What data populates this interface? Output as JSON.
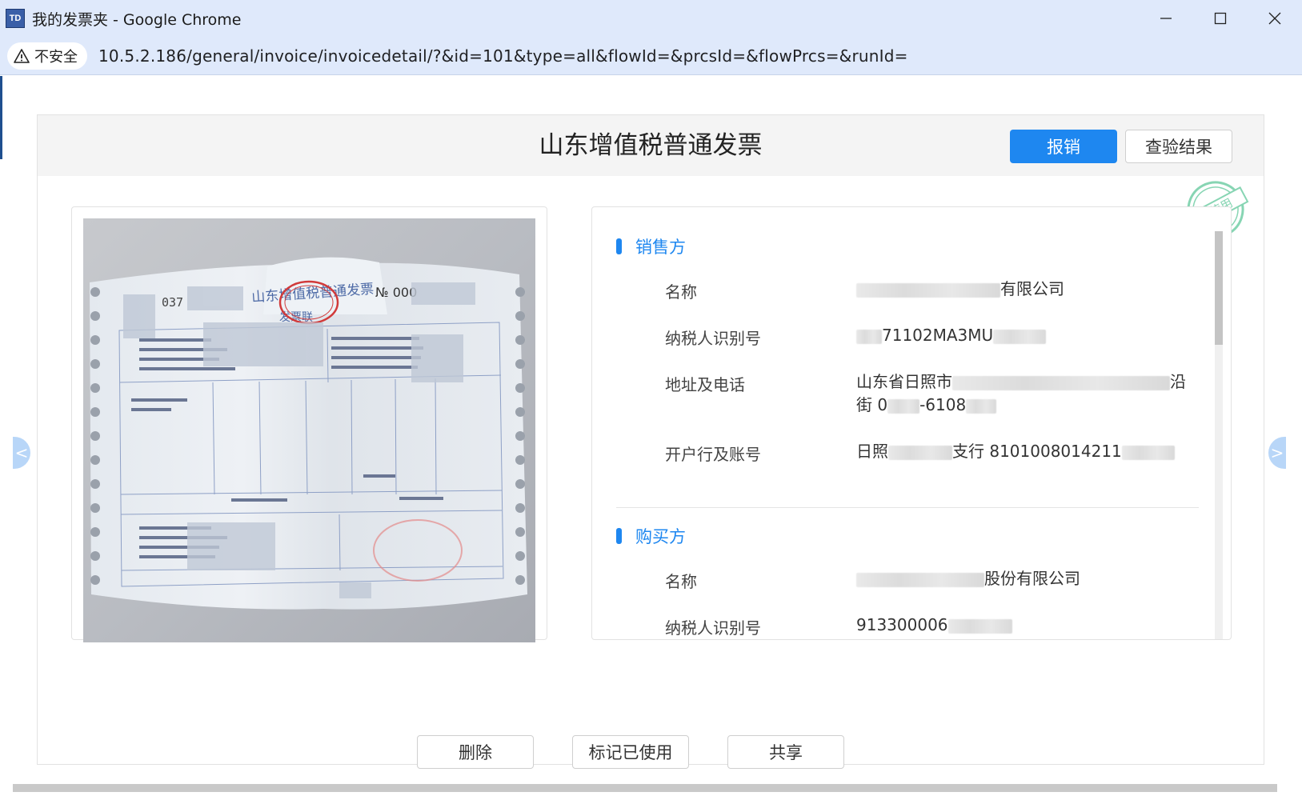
{
  "window": {
    "app_icon_text": "TD",
    "title": "我的发票夹 - Google Chrome"
  },
  "addressbar": {
    "security_label": "不安全",
    "url": "10.5.2.186/general/invoice/invoicedetail/?&id=101&type=all&flowId=&prcsId=&flowPrcs=&runId="
  },
  "invoice": {
    "title": "山东增值税普通发票",
    "reimburse_label": "报销",
    "verify_label": "查验结果",
    "stamp_text": "未使用"
  },
  "seller": {
    "section_title": "销售方",
    "name_label": "名称",
    "name_value": "有限公司",
    "taxid_label": "纳税人识别号",
    "taxid_value": "71102MA3MU",
    "address_label": "地址及电话",
    "address_value_1": "山东省日照市",
    "address_value_1_tail": "沿",
    "address_value_2_head": "街 0",
    "address_value_2_mid": "-6108",
    "bank_label": "开户行及账号",
    "bank_value_head": "日照",
    "bank_value_mid": "支行 8101008014211"
  },
  "buyer": {
    "section_title": "购买方",
    "name_label": "名称",
    "name_value": "股份有限公司",
    "taxid_label": "纳税人识别号",
    "taxid_value": "913300006"
  },
  "footer": {
    "delete_label": "删除",
    "mark_used_label": "标记已使用",
    "share_label": "共享"
  },
  "nav": {
    "prev_glyph": "<",
    "next_glyph": ">"
  },
  "colors": {
    "primary": "#1e87f0",
    "titlebar": "#dfe9fb",
    "stamp": "#5fc79a"
  }
}
